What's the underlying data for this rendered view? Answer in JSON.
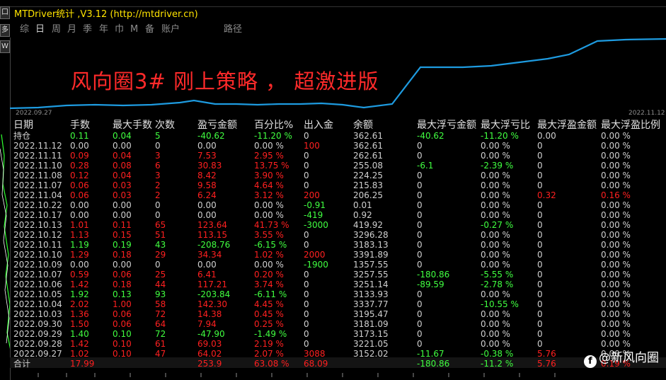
{
  "window": {
    "title": "MTDriver统计 ,V3.12 (http://mtdriver.cn)",
    "left_buttons": [
      "口",
      "多",
      "W"
    ]
  },
  "menu": {
    "items": [
      "综",
      "日",
      "周",
      "月",
      "季",
      "年",
      "巾",
      "M",
      "备",
      "账户"
    ],
    "active": "日",
    "path_label": "路径"
  },
  "overlay": {
    "title": "风向圈3# 刚上策略 ， 超激进版"
  },
  "equity_axis": {
    "start": "2022.09.27",
    "end": "2022.11.12"
  },
  "columns": [
    "日期",
    "手数",
    "最大手数",
    "次数",
    "盈亏金额",
    "百分比%",
    "出入金",
    "余额",
    "最大浮亏金额",
    "最大浮亏比",
    "最大浮盈金额",
    "最大浮盈比例"
  ],
  "rows": [
    {
      "date": "持仓",
      "lots": "0.11",
      "max_lots": "0.04",
      "count": "5",
      "pnl": "-40.62",
      "pct": "-11.20 %",
      "flow": "0",
      "balance": "362.61",
      "max_dd_amt": "-40.62",
      "max_dd_pct": "-11.20 %",
      "max_fp_amt": "0.00",
      "max_fp_pct": "0.00 %",
      "tone": "green"
    },
    {
      "date": "2022.11.12",
      "lots": "0.00",
      "max_lots": "0.00",
      "count": "0",
      "pnl": "0.00",
      "pct": "0.00 %",
      "flow": "100",
      "balance": "362.61",
      "max_dd_amt": "0",
      "max_dd_pct": "0.00 %",
      "max_fp_amt": "0",
      "max_fp_pct": "0.00 %",
      "tone": "white"
    },
    {
      "date": "2022.11.11",
      "lots": "0.09",
      "max_lots": "0.04",
      "count": "3",
      "pnl": "7.53",
      "pct": "2.95 %",
      "flow": "0",
      "balance": "262.61",
      "max_dd_amt": "0",
      "max_dd_pct": "0.00 %",
      "max_fp_amt": "0",
      "max_fp_pct": "0.00 %",
      "tone": "red"
    },
    {
      "date": "2022.11.10",
      "lots": "0.28",
      "max_lots": "0.08",
      "count": "6",
      "pnl": "30.83",
      "pct": "13.75 %",
      "flow": "0",
      "balance": "255.08",
      "max_dd_amt": "-6.1",
      "max_dd_pct": "-2.39 %",
      "max_fp_amt": "0",
      "max_fp_pct": "0.00 %",
      "tone": "red"
    },
    {
      "date": "2022.11.08",
      "lots": "0.12",
      "max_lots": "0.04",
      "count": "3",
      "pnl": "8.42",
      "pct": "3.90 %",
      "flow": "0",
      "balance": "224.25",
      "max_dd_amt": "0",
      "max_dd_pct": "0.00 %",
      "max_fp_amt": "0",
      "max_fp_pct": "0.00 %",
      "tone": "red"
    },
    {
      "date": "2022.11.07",
      "lots": "0.06",
      "max_lots": "0.03",
      "count": "2",
      "pnl": "9.58",
      "pct": "4.64 %",
      "flow": "0",
      "balance": "215.83",
      "max_dd_amt": "0",
      "max_dd_pct": "0.00 %",
      "max_fp_amt": "0",
      "max_fp_pct": "0.00 %",
      "tone": "red"
    },
    {
      "date": "2022.11.04",
      "lots": "0.06",
      "max_lots": "0.03",
      "count": "2",
      "pnl": "6.24",
      "pct": "3.12 %",
      "flow": "200",
      "balance": "206.25",
      "max_dd_amt": "0",
      "max_dd_pct": "0.00 %",
      "max_fp_amt": "0.32",
      "max_fp_pct": "0.16 %",
      "tone": "red"
    },
    {
      "date": "2022.10.22",
      "lots": "0.00",
      "max_lots": "0.00",
      "count": "0",
      "pnl": "0.00",
      "pct": "0.00 %",
      "flow": "-0.91",
      "balance": "0.01",
      "max_dd_amt": "0",
      "max_dd_pct": "0.00 %",
      "max_fp_amt": "0",
      "max_fp_pct": "0.00 %",
      "tone": "white"
    },
    {
      "date": "2022.10.17",
      "lots": "0.00",
      "max_lots": "0.00",
      "count": "0",
      "pnl": "0.00",
      "pct": "0.00 %",
      "flow": "-419",
      "balance": "0.92",
      "max_dd_amt": "0",
      "max_dd_pct": "0.00 %",
      "max_fp_amt": "0",
      "max_fp_pct": "0.00 %",
      "tone": "white"
    },
    {
      "date": "2022.10.13",
      "lots": "1.01",
      "max_lots": "0.11",
      "count": "65",
      "pnl": "123.64",
      "pct": "41.73 %",
      "flow": "-3000",
      "balance": "419.92",
      "max_dd_amt": "0",
      "max_dd_pct": "-0.27 %",
      "max_fp_amt": "0",
      "max_fp_pct": "0.00 %",
      "tone": "red"
    },
    {
      "date": "2022.10.12",
      "lots": "1.13",
      "max_lots": "0.15",
      "count": "51",
      "pnl": "113.15",
      "pct": "3.55 %",
      "flow": "0",
      "balance": "3296.28",
      "max_dd_amt": "0",
      "max_dd_pct": "0.00 %",
      "max_fp_amt": "0",
      "max_fp_pct": "0.00 %",
      "tone": "red"
    },
    {
      "date": "2022.10.11",
      "lots": "1.19",
      "max_lots": "0.19",
      "count": "43",
      "pnl": "-208.76",
      "pct": "-6.15 %",
      "flow": "0",
      "balance": "3183.13",
      "max_dd_amt": "0",
      "max_dd_pct": "0.00 %",
      "max_fp_amt": "0",
      "max_fp_pct": "0.00 %",
      "tone": "green"
    },
    {
      "date": "2022.10.10",
      "lots": "1.29",
      "max_lots": "0.18",
      "count": "29",
      "pnl": "34.34",
      "pct": "1.02 %",
      "flow": "2000",
      "balance": "3391.89",
      "max_dd_amt": "0",
      "max_dd_pct": "0.00 %",
      "max_fp_amt": "0",
      "max_fp_pct": "0.00 %",
      "tone": "red"
    },
    {
      "date": "2022.10.09",
      "lots": "0.00",
      "max_lots": "0.00",
      "count": "0",
      "pnl": "0.00",
      "pct": "0.00 %",
      "flow": "-1900",
      "balance": "1357.55",
      "max_dd_amt": "0",
      "max_dd_pct": "0.00 %",
      "max_fp_amt": "0",
      "max_fp_pct": "0.00 %",
      "tone": "white"
    },
    {
      "date": "2022.10.07",
      "lots": "0.59",
      "max_lots": "0.06",
      "count": "25",
      "pnl": "6.41",
      "pct": "0.20 %",
      "flow": "0",
      "balance": "3257.55",
      "max_dd_amt": "-180.86",
      "max_dd_pct": "-5.55 %",
      "max_fp_amt": "0",
      "max_fp_pct": "0.00 %",
      "tone": "red"
    },
    {
      "date": "2022.10.06",
      "lots": "1.42",
      "max_lots": "0.18",
      "count": "44",
      "pnl": "117.21",
      "pct": "3.74 %",
      "flow": "0",
      "balance": "3251.14",
      "max_dd_amt": "-89.59",
      "max_dd_pct": "-2.78 %",
      "max_fp_amt": "0",
      "max_fp_pct": "0.00 %",
      "tone": "red"
    },
    {
      "date": "2022.10.05",
      "lots": "1.92",
      "max_lots": "0.13",
      "count": "93",
      "pnl": "-203.84",
      "pct": "-6.11 %",
      "flow": "0",
      "balance": "3133.93",
      "max_dd_amt": "0",
      "max_dd_pct": "0.00 %",
      "max_fp_amt": "0",
      "max_fp_pct": "0.00 %",
      "tone": "green"
    },
    {
      "date": "2022.10.04",
      "lots": "2.02",
      "max_lots": "1.00",
      "count": "58",
      "pnl": "142.30",
      "pct": "4.45 %",
      "flow": "0",
      "balance": "3337.77",
      "max_dd_amt": "0",
      "max_dd_pct": "-10.55 %",
      "max_fp_amt": "0",
      "max_fp_pct": "0.00 %",
      "tone": "red"
    },
    {
      "date": "2022.10.03",
      "lots": "1.36",
      "max_lots": "0.06",
      "count": "72",
      "pnl": "14.38",
      "pct": "0.45 %",
      "flow": "0",
      "balance": "3195.47",
      "max_dd_amt": "0",
      "max_dd_pct": "0.00 %",
      "max_fp_amt": "0",
      "max_fp_pct": "0.00 %",
      "tone": "red"
    },
    {
      "date": "2022.09.30",
      "lots": "1.50",
      "max_lots": "0.06",
      "count": "64",
      "pnl": "7.94",
      "pct": "0.25 %",
      "flow": "0",
      "balance": "3181.09",
      "max_dd_amt": "0",
      "max_dd_pct": "0.00 %",
      "max_fp_amt": "0",
      "max_fp_pct": "0.00 %",
      "tone": "red"
    },
    {
      "date": "2022.09.29",
      "lots": "1.40",
      "max_lots": "0.10",
      "count": "72",
      "pnl": "-47.90",
      "pct": "-1.49 %",
      "flow": "0",
      "balance": "3173.15",
      "max_dd_amt": "0",
      "max_dd_pct": "0.00 %",
      "max_fp_amt": "0",
      "max_fp_pct": "0.00 %",
      "tone": "green"
    },
    {
      "date": "2022.09.28",
      "lots": "1.42",
      "max_lots": "0.10",
      "count": "61",
      "pnl": "69.03",
      "pct": "2.19 %",
      "flow": "0",
      "balance": "3221.05",
      "max_dd_amt": "0",
      "max_dd_pct": "0.00 %",
      "max_fp_amt": "0",
      "max_fp_pct": "0.00 %",
      "tone": "red"
    },
    {
      "date": "2022.09.27",
      "lots": "1.02",
      "max_lots": "0.10",
      "count": "47",
      "pnl": "64.02",
      "pct": "2.07 %",
      "flow": "3088",
      "balance": "3152.02",
      "max_dd_amt": "-11.67",
      "max_dd_pct": "-0.38 %",
      "max_fp_amt": "5.76",
      "max_fp_pct": "0.00 %",
      "tone": "red"
    }
  ],
  "total": {
    "label": "合计",
    "lots": "17.99",
    "pnl": "253.9",
    "pct": "63.08 %",
    "flow": "68.09",
    "max_dd_amt": "-180.86",
    "max_dd_pct": "-11.2 %",
    "max_fp_amt": "5.76",
    "max_fp_pct": "0.19 %"
  },
  "watermark": {
    "logo": "f",
    "text": "@新风向圈"
  },
  "colors": {
    "yellow_title": "#ffe400",
    "profit": "#ff2020",
    "loss": "#40ff40",
    "neutral": "#d0d0d0",
    "curve": "#1e9be0",
    "selection": "#0000c8"
  }
}
